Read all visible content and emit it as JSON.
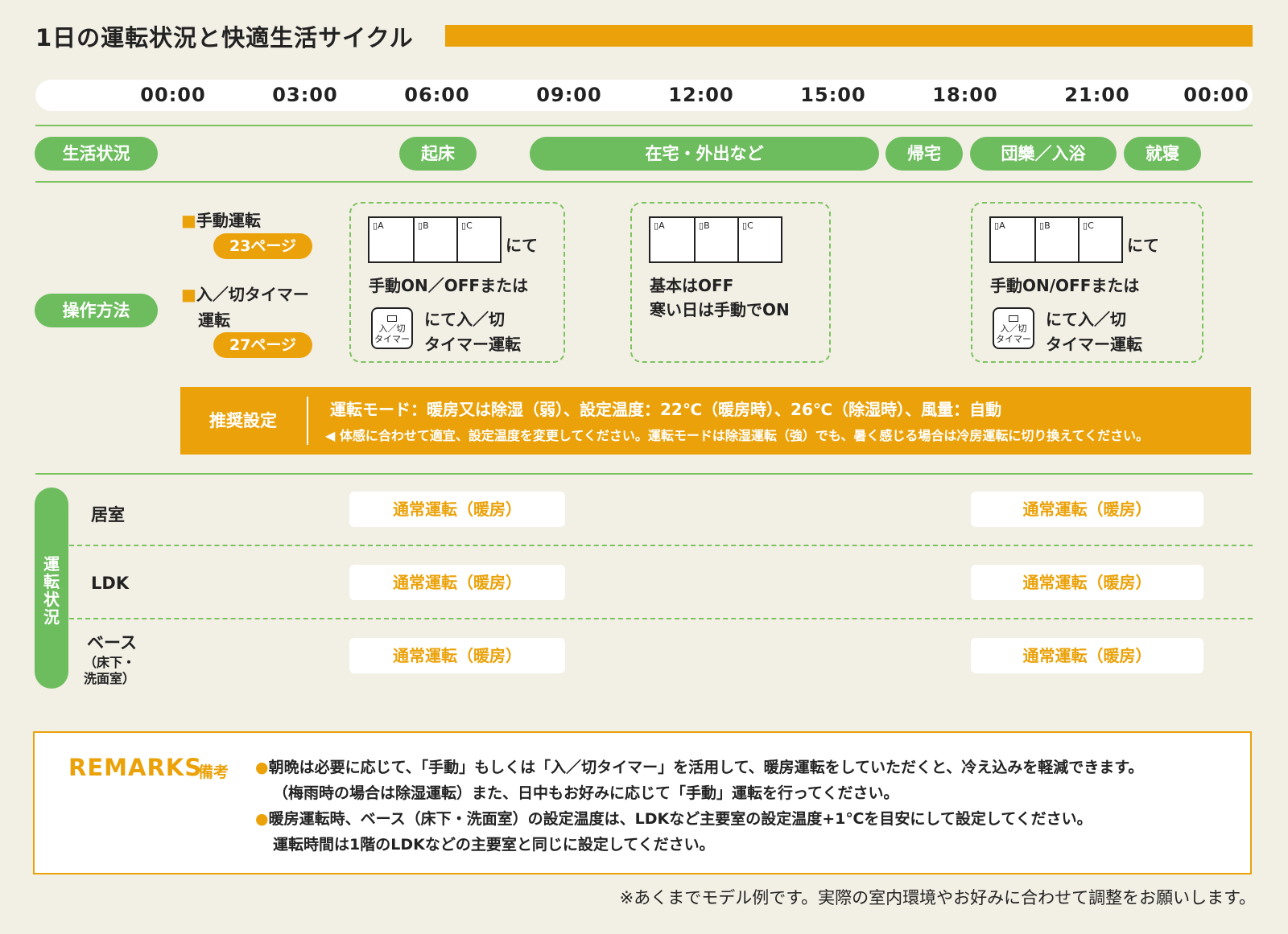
{
  "title": "1日の運転状況と快適生活サイクル",
  "timeline": [
    "00:00",
    "03:00",
    "06:00",
    "09:00",
    "12:00",
    "15:00",
    "18:00",
    "21:00",
    "00:00"
  ],
  "life": {
    "label": "生活状況",
    "events": [
      "起床",
      "在宅・外出など",
      "帰宅",
      "団欒／入浴",
      "就寝"
    ]
  },
  "operation": {
    "label": "操作方法",
    "manual_label": "手動運転",
    "manual_page": "23ページ",
    "timer_label_1": "入／切タイマー",
    "timer_label_2": "運転",
    "timer_page": "27ページ",
    "square": "■",
    "keys": [
      "A",
      "B",
      "C"
    ],
    "key_box": "▯",
    "nite": "にて",
    "box1_line1": "手動ON／OFFまたは",
    "box3_line1": "手動ON/OFFまたは",
    "timer_icon_1": "入／切",
    "timer_icon_2": "タイマー",
    "timer_text_1": "にて入／切",
    "timer_text_2": "タイマー運転",
    "box2_line1": "基本はOFF",
    "box2_line2": "寒い日は手動でON"
  },
  "recommended": {
    "label": "推奨設定",
    "line1": "運転モード：暖房又は除湿（弱）、設定温度：22℃（暖房時）、26℃（除湿時）、風量：自動",
    "line2": "◀ 体感に合わせて適宜、設定温度を変更してください。運転モードは除湿運転（強）でも、暑く感じる場合は冷房運転に切り換えてください。"
  },
  "status": {
    "label": "運転状況",
    "rows": [
      {
        "name": "居室",
        "sub": ""
      },
      {
        "name": "LDK",
        "sub": ""
      },
      {
        "name": "ベース",
        "sub": "（床下・\n洗面室）"
      }
    ],
    "mode": "通常運転（暖房）"
  },
  "remarks": {
    "heading": "REMARKS",
    "heading_sub": "備考",
    "bullet": "●",
    "line1": "朝晩は必要に応じて、「手動」もしくは「入／切タイマー」を活用して、暖房運転をしていただくと、冷え込みを軽減できます。",
    "line2": "（梅雨時の場合は除湿運転）また、日中もお好みに応じて「手動」運転を行ってください。",
    "line3": "暖房運転時、ベース（床下・洗面室）の設定温度は、LDKなど主要室の設定温度+1℃を目安にして設定してください。",
    "line4": "運転時間は1階のLDKなどの主要室と同じに設定してください。"
  },
  "footnote": "※あくまでモデル例です。実際の室内環境やお好みに合わせて調整をお願いします。",
  "colors": {
    "green": "#6dbd5e",
    "orange": "#eba20a",
    "background": "#f2efe5"
  }
}
